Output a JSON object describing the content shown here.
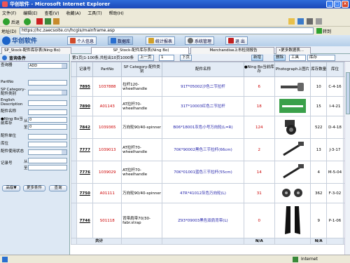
{
  "window": {
    "title": "华创软件 - Microsoft Internet Explorer",
    "min": "_",
    "max": "□",
    "close": "×"
  },
  "menu": [
    "文件(F)",
    "编辑(E)",
    "查看(V)",
    "收藏(A)",
    "工具(T)",
    "帮助(H)"
  ],
  "ie_toolbar": {
    "back": "后退",
    "forward_glyph": "▸"
  },
  "address": {
    "label": "地址(D)",
    "url": "https://hc.zaecsoite.cn/hcgis/mainframe.asp",
    "go": "转到"
  },
  "app": {
    "logo": "华创软件",
    "nav": [
      {
        "label": "个人信息",
        "color": "#d04a2a"
      },
      {
        "label": "数据库",
        "color": "#2a6fd0"
      },
      {
        "label": "统计报表",
        "color": "#d0a02a"
      },
      {
        "label": "系统管理",
        "color": "#6a6a6a"
      },
      {
        "label": "退 出",
        "color": "#c02020"
      }
    ],
    "tabs": [
      "SP_Stock-配件库存表(Ning Bo)",
      "SP_Stock-配件库存表(Ning Bo)",
      "Merchandise上市检测报告",
      "•更多数据表..."
    ]
  },
  "left_panel": {
    "db_label": "查询器",
    "db_value": "ADD",
    "title": "查询条件",
    "fields": [
      {
        "label": "PartNo"
      },
      {
        "label": "SP Category-配件类别"
      },
      {
        "label": "English Description"
      },
      {
        "label": "配件名称"
      }
    ],
    "ningbo_label": "●Ning Bo当前库存",
    "ningbo_from": "0",
    "ningbo_to": "0",
    "from": "从",
    "to": "至",
    "unit_label": "配件单位",
    "location_label": "库位",
    "status_label": "配件使用状态",
    "record_label": "记录号",
    "buttons": [
      "高级▼",
      "更多条件",
      "查询"
    ]
  },
  "pager": {
    "text": "第1页|1-100条,共检出10页1000条",
    "prev": "上一页",
    "page": "1",
    "next": "下页",
    "new": "新增",
    "delete": "删除",
    "tools": "工具",
    "library": "库存"
  },
  "grid": {
    "headers": [
      "记录号",
      "PartNo",
      "SP Category-配件类别",
      "配件名称",
      "●Ning Bo当前库存",
      "Photograph上图片",
      "库存数量",
      "库位"
    ],
    "rows": [
      {
        "id": "7895",
        "part": "1037888",
        "cat": "拉杆120-wheelhandle",
        "name": "91T*05002沙色二节拉杆",
        "stock": "6",
        "qty": "10",
        "loc": "C-4-16",
        "photo": "handle"
      },
      {
        "id": "7890",
        "part": "A01143",
        "cat": "AT拉杆70-wheelhandle",
        "name": "31T*10003红色二节拉杆",
        "stock": "18",
        "qty": "15",
        "loc": "I-4-21",
        "photo": "green"
      },
      {
        "id": "7842",
        "part": "1039365",
        "cat": "万向轮90/40-spinner",
        "name": "B06*18001灰色小号万向轮(L=R)",
        "stock": "124",
        "qty": "522",
        "loc": "D-4-18",
        "photo": "wheel"
      },
      {
        "id": "7777",
        "part": "1039013",
        "cat": "AT拉杆70-wheelhandle",
        "name": "70K*90002黑色三节拉杆(66cm)",
        "stock": "2",
        "qty": "13",
        "loc": "J-3-17",
        "photo": "rod"
      },
      {
        "id": "7776",
        "part": "1039029",
        "cat": "AT拉杆70-wheelhandle",
        "name": "70K*01001蓝色三节拉杆(55cm)",
        "stock": "14",
        "qty": "4",
        "loc": "M-5-04",
        "photo": "rod"
      },
      {
        "id": "7750",
        "part": "A01111",
        "cat": "万向轮90/40-spinner",
        "name": "47R*41012灰色万向轮(L)",
        "stock": "31",
        "qty": "362",
        "loc": "F-3-02",
        "photo": "wheels"
      },
      {
        "id": "7746",
        "part": "S01118",
        "cat": "背带肩带70/30-fabr.strap",
        "name": "Z93*09003黑色双肩背带(L)",
        "stock": "0",
        "qty": "9",
        "loc": "P-1-06",
        "photo": "strap"
      }
    ],
    "footer": {
      "label": "共计",
      "na1": "N/A",
      "na2": "N/A"
    }
  },
  "status": {
    "zone": "Internet"
  }
}
